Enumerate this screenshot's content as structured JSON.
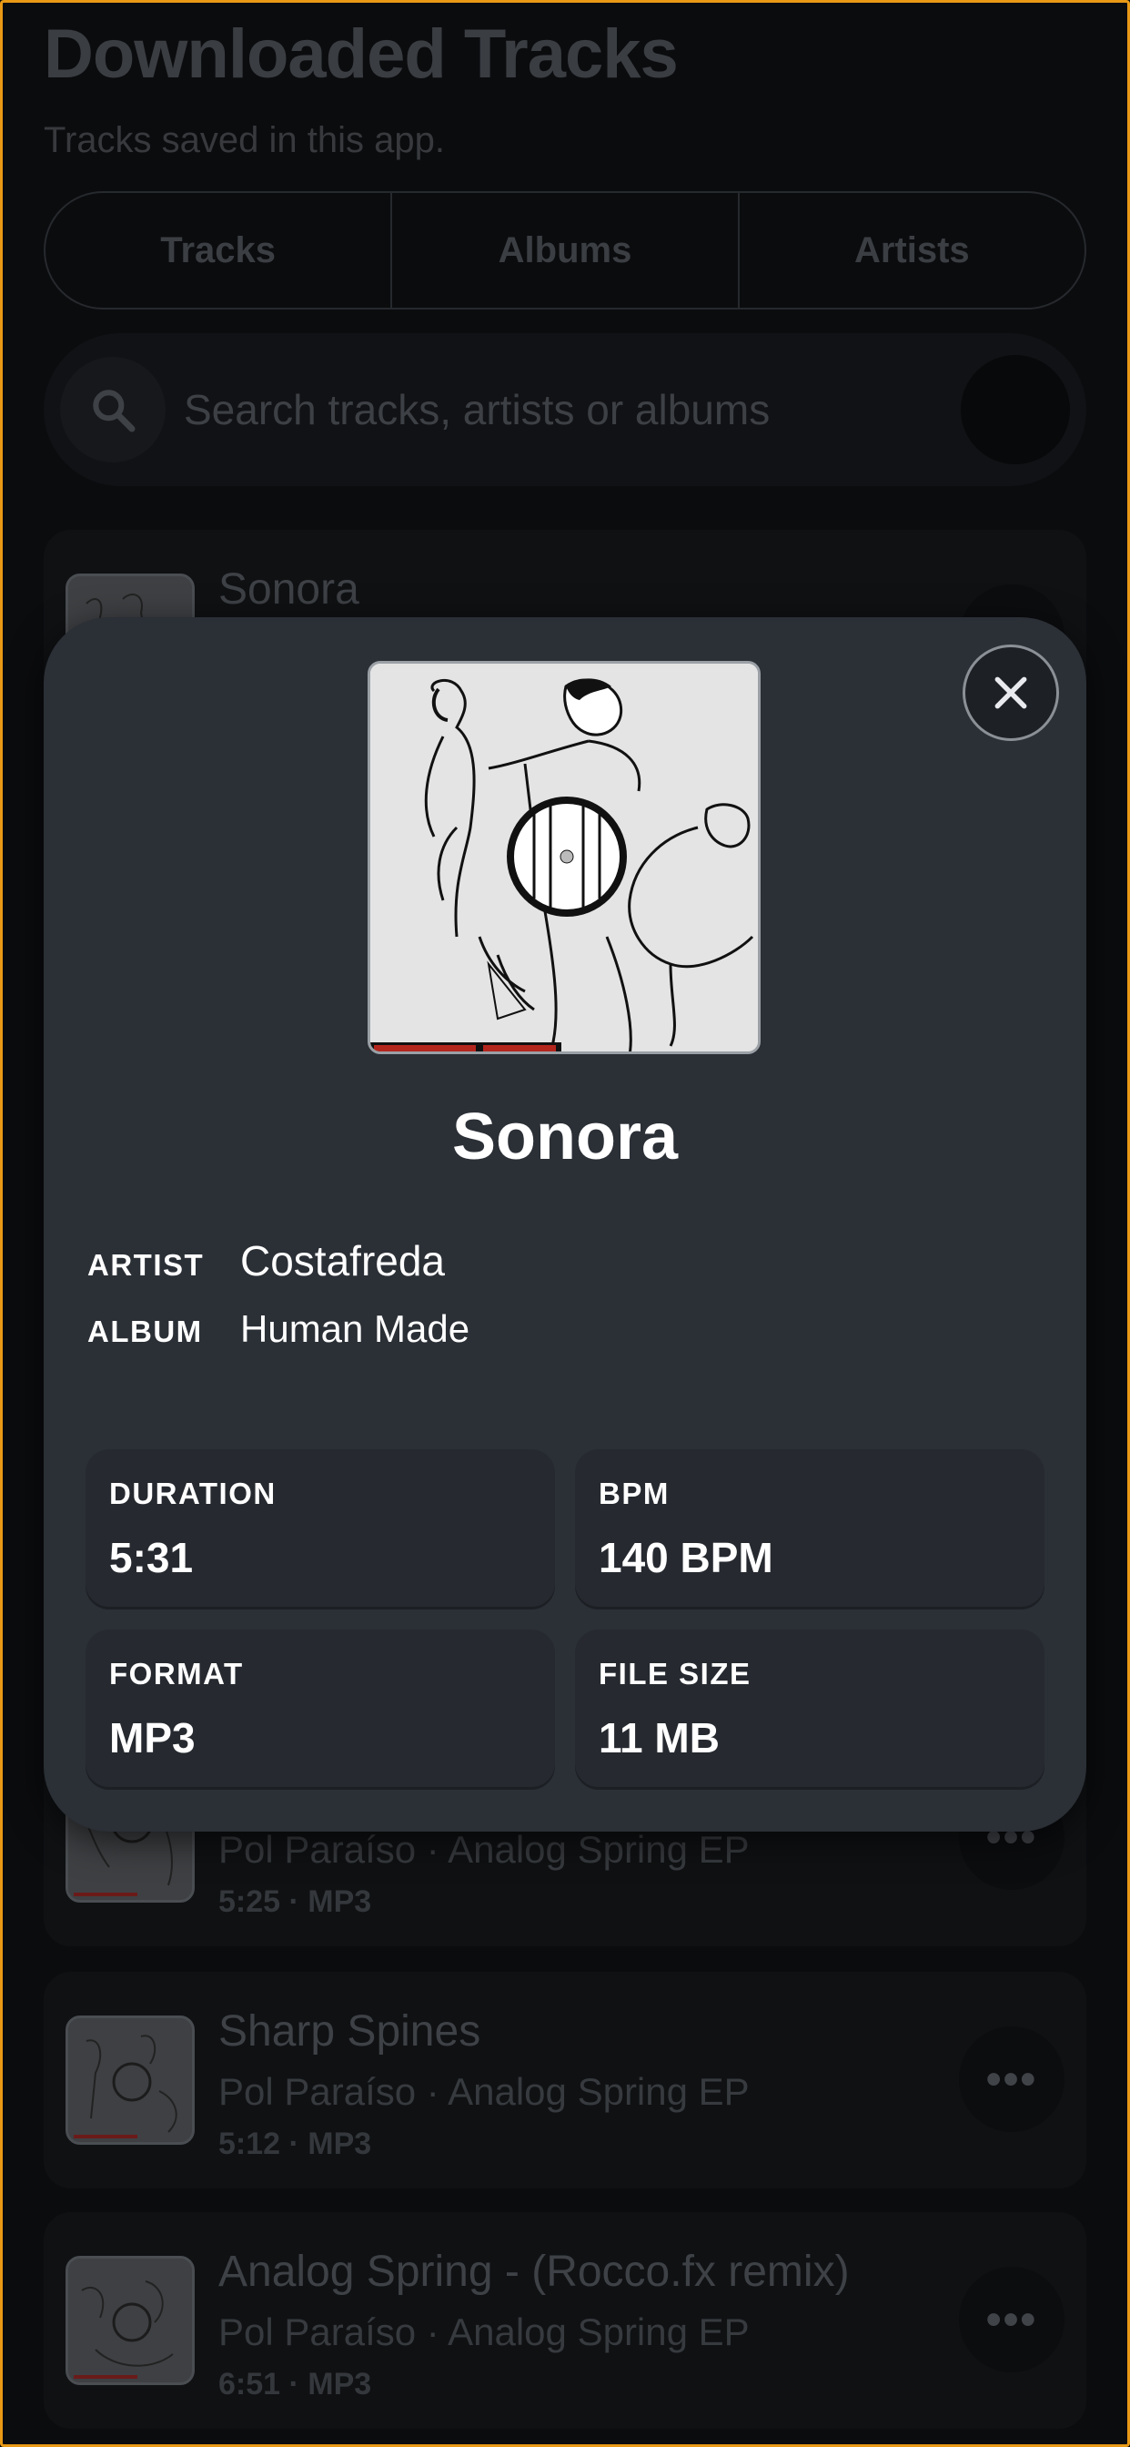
{
  "header": {
    "title": "Downloaded Tracks",
    "subtitle": "Tracks saved in this app."
  },
  "tabs": [
    {
      "label": "Tracks"
    },
    {
      "label": "Albums"
    },
    {
      "label": "Artists"
    }
  ],
  "search": {
    "placeholder": "Search tracks, artists or albums",
    "icon": "search-icon"
  },
  "tracks": [
    {
      "title": "Sonora",
      "subtitle": "",
      "meta": ""
    },
    {
      "title": "",
      "subtitle": "Pol Paraíso · Analog Spring EP",
      "meta": "5:25 · MP3"
    },
    {
      "title": "Sharp Spines",
      "subtitle": "Pol Paraíso · Analog Spring EP",
      "meta": "5:12 · MP3"
    },
    {
      "title": "Analog Spring - (Rocco.fx remix)",
      "subtitle": "Pol Paraíso · Analog Spring EP",
      "meta": "6:51 · MP3"
    }
  ],
  "more_label": "•••",
  "modal": {
    "title": "Sonora",
    "artist_label": "ARTIST",
    "artist": "Costafreda",
    "album_label": "ALBUM",
    "album": "Human Made",
    "stats": [
      {
        "label": "DURATION",
        "value": "5:31"
      },
      {
        "label": "BPM",
        "value": "140 BPM"
      },
      {
        "label": "FORMAT",
        "value": "MP3"
      },
      {
        "label": "FILE SIZE",
        "value": "11 MB"
      }
    ],
    "close_icon": "close-icon"
  },
  "colors": {
    "background": "#0b0c0e",
    "modal": "#2b2f36",
    "stat_card": "#262a30",
    "frame": "#e89a16"
  }
}
